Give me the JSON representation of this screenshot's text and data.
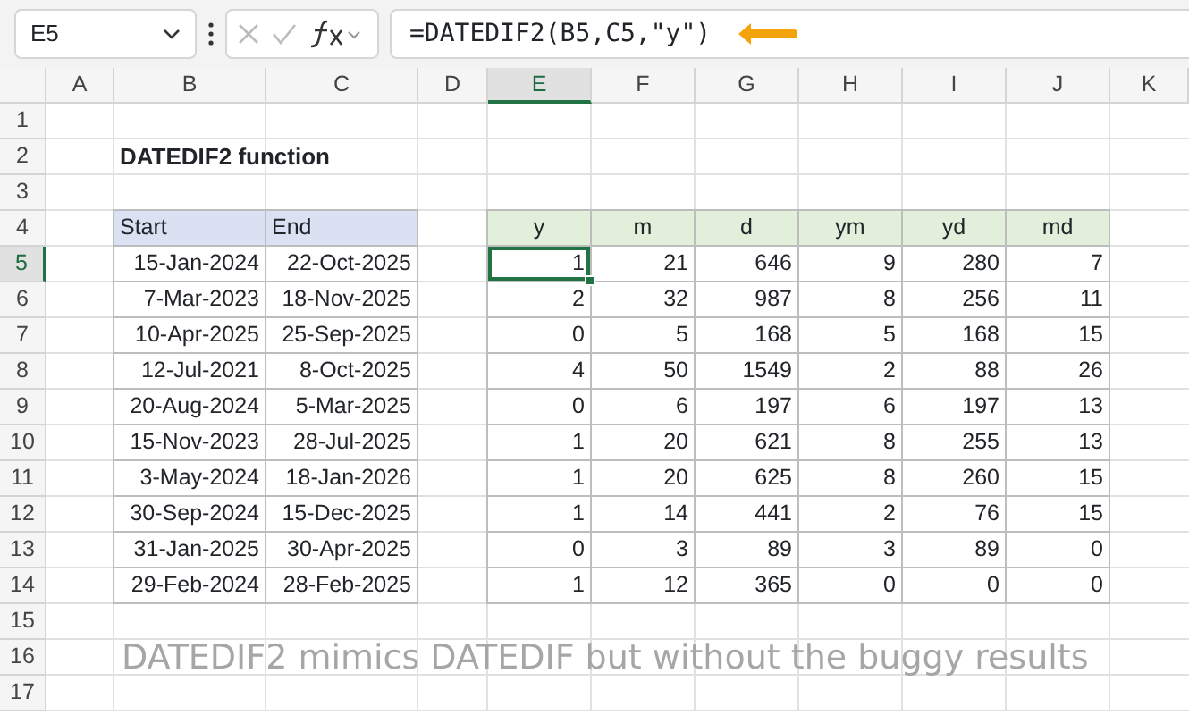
{
  "formula_bar": {
    "name_box": "E5",
    "formula": "=DATEDIF2(B5,C5,\"y\")"
  },
  "columns": [
    {
      "label": "A",
      "selected": false
    },
    {
      "label": "B",
      "selected": false
    },
    {
      "label": "C",
      "selected": false
    },
    {
      "label": "D",
      "selected": false
    },
    {
      "label": "E",
      "selected": true
    },
    {
      "label": "F",
      "selected": false
    },
    {
      "label": "G",
      "selected": false
    },
    {
      "label": "H",
      "selected": false
    },
    {
      "label": "I",
      "selected": false
    },
    {
      "label": "J",
      "selected": false
    },
    {
      "label": "K",
      "selected": false
    }
  ],
  "rows": [
    {
      "label": "1",
      "selected": false
    },
    {
      "label": "2",
      "selected": false
    },
    {
      "label": "3",
      "selected": false
    },
    {
      "label": "4",
      "selected": false
    },
    {
      "label": "5",
      "selected": true
    },
    {
      "label": "6",
      "selected": false
    },
    {
      "label": "7",
      "selected": false
    },
    {
      "label": "8",
      "selected": false
    },
    {
      "label": "9",
      "selected": false
    },
    {
      "label": "10",
      "selected": false
    },
    {
      "label": "11",
      "selected": false
    },
    {
      "label": "12",
      "selected": false
    },
    {
      "label": "13",
      "selected": false
    },
    {
      "label": "14",
      "selected": false
    },
    {
      "label": "15",
      "selected": false
    },
    {
      "label": "16",
      "selected": false
    },
    {
      "label": "17",
      "selected": false
    }
  ],
  "title": "DATEDIF2 function",
  "dates": {
    "columns": [
      "Start",
      "End"
    ],
    "rows": [
      [
        "15-Jan-2024",
        "22-Oct-2025"
      ],
      [
        "7-Mar-2023",
        "18-Nov-2025"
      ],
      [
        "10-Apr-2025",
        "25-Sep-2025"
      ],
      [
        "12-Jul-2021",
        "8-Oct-2025"
      ],
      [
        "20-Aug-2024",
        "5-Mar-2025"
      ],
      [
        "15-Nov-2023",
        "28-Jul-2025"
      ],
      [
        "3-May-2024",
        "18-Jan-2026"
      ],
      [
        "30-Sep-2024",
        "15-Dec-2025"
      ],
      [
        "31-Jan-2025",
        "30-Apr-2025"
      ],
      [
        "29-Feb-2024",
        "28-Feb-2025"
      ]
    ]
  },
  "results": {
    "columns": [
      "y",
      "m",
      "d",
      "ym",
      "yd",
      "md"
    ],
    "rows": [
      [
        {
          "value": "1",
          "selected": true
        },
        {
          "value": "21",
          "selected": false
        },
        {
          "value": "646",
          "selected": false
        },
        {
          "value": "9",
          "selected": false
        },
        {
          "value": "280",
          "selected": false
        },
        {
          "value": "7",
          "selected": false
        }
      ],
      [
        {
          "value": "2",
          "selected": false
        },
        {
          "value": "32",
          "selected": false
        },
        {
          "value": "987",
          "selected": false
        },
        {
          "value": "8",
          "selected": false
        },
        {
          "value": "256",
          "selected": false
        },
        {
          "value": "11",
          "selected": false
        }
      ],
      [
        {
          "value": "0",
          "selected": false
        },
        {
          "value": "5",
          "selected": false
        },
        {
          "value": "168",
          "selected": false
        },
        {
          "value": "5",
          "selected": false
        },
        {
          "value": "168",
          "selected": false
        },
        {
          "value": "15",
          "selected": false
        }
      ],
      [
        {
          "value": "4",
          "selected": false
        },
        {
          "value": "50",
          "selected": false
        },
        {
          "value": "1549",
          "selected": false
        },
        {
          "value": "2",
          "selected": false
        },
        {
          "value": "88",
          "selected": false
        },
        {
          "value": "26",
          "selected": false
        }
      ],
      [
        {
          "value": "0",
          "selected": false
        },
        {
          "value": "6",
          "selected": false
        },
        {
          "value": "197",
          "selected": false
        },
        {
          "value": "6",
          "selected": false
        },
        {
          "value": "197",
          "selected": false
        },
        {
          "value": "13",
          "selected": false
        }
      ],
      [
        {
          "value": "1",
          "selected": false
        },
        {
          "value": "20",
          "selected": false
        },
        {
          "value": "621",
          "selected": false
        },
        {
          "value": "8",
          "selected": false
        },
        {
          "value": "255",
          "selected": false
        },
        {
          "value": "13",
          "selected": false
        }
      ],
      [
        {
          "value": "1",
          "selected": false
        },
        {
          "value": "20",
          "selected": false
        },
        {
          "value": "625",
          "selected": false
        },
        {
          "value": "8",
          "selected": false
        },
        {
          "value": "260",
          "selected": false
        },
        {
          "value": "15",
          "selected": false
        }
      ],
      [
        {
          "value": "1",
          "selected": false
        },
        {
          "value": "14",
          "selected": false
        },
        {
          "value": "441",
          "selected": false
        },
        {
          "value": "2",
          "selected": false
        },
        {
          "value": "76",
          "selected": false
        },
        {
          "value": "15",
          "selected": false
        }
      ],
      [
        {
          "value": "0",
          "selected": false
        },
        {
          "value": "3",
          "selected": false
        },
        {
          "value": "89",
          "selected": false
        },
        {
          "value": "3",
          "selected": false
        },
        {
          "value": "89",
          "selected": false
        },
        {
          "value": "0",
          "selected": false
        }
      ],
      [
        {
          "value": "1",
          "selected": false
        },
        {
          "value": "12",
          "selected": false
        },
        {
          "value": "365",
          "selected": false
        },
        {
          "value": "0",
          "selected": false
        },
        {
          "value": "0",
          "selected": false
        },
        {
          "value": "0",
          "selected": false
        }
      ]
    ]
  },
  "note": "DATEDIF2 mimics DATEDIF but without the buggy results"
}
